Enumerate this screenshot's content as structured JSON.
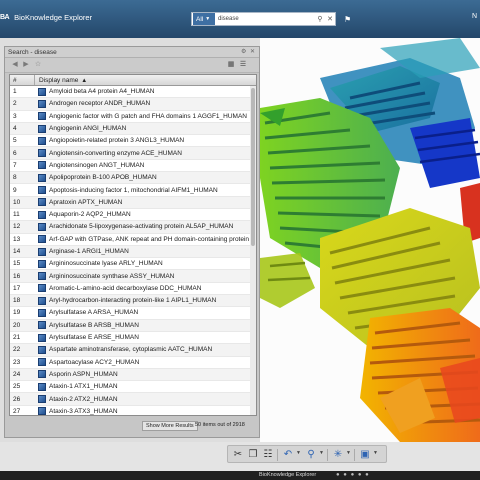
{
  "header": {
    "logo": "BA",
    "app_title": "BioKnowledge Explorer",
    "scope": "All",
    "search_value": "disease",
    "user_fragment": "N"
  },
  "panel": {
    "title": "Search - disease",
    "column_header": "Display name",
    "rows": [
      {
        "num": "1",
        "name": "Amyloid beta A4 protein A4_HUMAN"
      },
      {
        "num": "2",
        "name": "Androgen receptor ANDR_HUMAN"
      },
      {
        "num": "3",
        "name": "Angiogenic factor with G patch and FHA domains 1 AGGF1_HUMAN"
      },
      {
        "num": "4",
        "name": "Angiogenin ANGI_HUMAN"
      },
      {
        "num": "5",
        "name": "Angiopoietin-related protein 3 ANGL3_HUMAN"
      },
      {
        "num": "6",
        "name": "Angiotensin-converting enzyme ACE_HUMAN"
      },
      {
        "num": "7",
        "name": "Angiotensinogen ANGT_HUMAN"
      },
      {
        "num": "8",
        "name": "Apolipoprotein B-100 APOB_HUMAN"
      },
      {
        "num": "9",
        "name": "Apoptosis-inducing factor 1, mitochondrial AIFM1_HUMAN"
      },
      {
        "num": "10",
        "name": "Apratoxin APTX_HUMAN"
      },
      {
        "num": "11",
        "name": "Aquaporin-2 AQP2_HUMAN"
      },
      {
        "num": "12",
        "name": "Arachidonate 5-lipoxygenase-activating protein AL5AP_HUMAN"
      },
      {
        "num": "13",
        "name": "Arf-GAP with GTPase, ANK repeat and PH domain-containing protein 3"
      },
      {
        "num": "14",
        "name": "Arginase-1 ARGI1_HUMAN"
      },
      {
        "num": "15",
        "name": "Argininosuccinate lyase ARLY_HUMAN"
      },
      {
        "num": "16",
        "name": "Argininosuccinate synthase ASSY_HUMAN"
      },
      {
        "num": "17",
        "name": "Aromatic-L-amino-acid decarboxylase DDC_HUMAN"
      },
      {
        "num": "18",
        "name": "Aryl-hydrocarbon-interacting protein-like 1 AIPL1_HUMAN"
      },
      {
        "num": "19",
        "name": "Arylsulfatase A ARSA_HUMAN"
      },
      {
        "num": "20",
        "name": "Arylsulfatase B ARSB_HUMAN"
      },
      {
        "num": "21",
        "name": "Arylsulfatase E ARSE_HUMAN"
      },
      {
        "num": "22",
        "name": "Aspartate aminotransferase, cytoplasmic AATC_HUMAN"
      },
      {
        "num": "23",
        "name": "Aspartoacylase ACY2_HUMAN"
      },
      {
        "num": "24",
        "name": "Asporin ASPN_HUMAN"
      },
      {
        "num": "25",
        "name": "Ataxin-1 ATX1_HUMAN"
      },
      {
        "num": "26",
        "name": "Ataxin-2 ATX2_HUMAN"
      },
      {
        "num": "27",
        "name": "Ataxin-3 ATX3_HUMAN"
      }
    ],
    "show_more_label": "Show More Results",
    "count_label": "50 items out of 2918"
  },
  "bottom": {
    "caption": "BioKnowledge Explorer",
    "page_dots": "● ● ● ● ●"
  },
  "icons": {
    "back": "back-arrow-icon",
    "forward": "forward-arrow-icon",
    "favorite": "star-icon",
    "grid_view": "grid-view-icon",
    "list_view": "list-view-icon",
    "cut": "scissors-icon",
    "copy": "copy-icon",
    "paste": "paste-icon",
    "undo": "undo-icon",
    "zoom": "magnify-icon",
    "network": "network-icon",
    "window": "window-icon"
  },
  "colors": {
    "header_top": "#3c6b94",
    "header_bottom": "#24476a",
    "scope_blue": "#3e6fa3",
    "row_icon": "#2f5f9f"
  }
}
